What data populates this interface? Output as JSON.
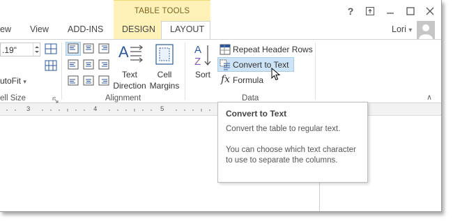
{
  "titlebar": {
    "context_tab_title": "TABLE TOOLS",
    "help_label": "?",
    "restore_label": "▣",
    "minimize_label": "—",
    "maximize_label": "□",
    "close_label": "✕"
  },
  "tabs": {
    "view_partial": "ew",
    "view": "View",
    "addins": "ADD-INS",
    "design": "DESIGN",
    "layout": "LAYOUT"
  },
  "user": {
    "name": "Lori",
    "dropdown_glyph": "▾"
  },
  "ribbon": {
    "cell_size": {
      "height_value": ".19\"",
      "autofit_label": "utoFit",
      "group_label": "ell Size"
    },
    "alignment": {
      "text_direction_line1": "Text",
      "text_direction_line2": "Direction",
      "cell_margins_line1": "Cell",
      "cell_margins_line2": "Margins",
      "group_label": "Alignment"
    },
    "data": {
      "sort_label": "Sort",
      "repeat_header_rows": "Repeat Header Rows",
      "convert_to_text": "Convert to Text",
      "formula": "Formula",
      "group_label": "Data"
    },
    "collapse_glyph": "∧"
  },
  "ruler": {
    "marks": [
      "3",
      "4",
      "5"
    ]
  },
  "tooltip": {
    "title": "Convert to Text",
    "line1": "Convert the table to regular text.",
    "line2": "You can choose which text character to use to separate the columns."
  },
  "colors": {
    "contextual_tab": "#fff2b8",
    "highlight": "#cde4f7",
    "accent": "#2b579a"
  }
}
